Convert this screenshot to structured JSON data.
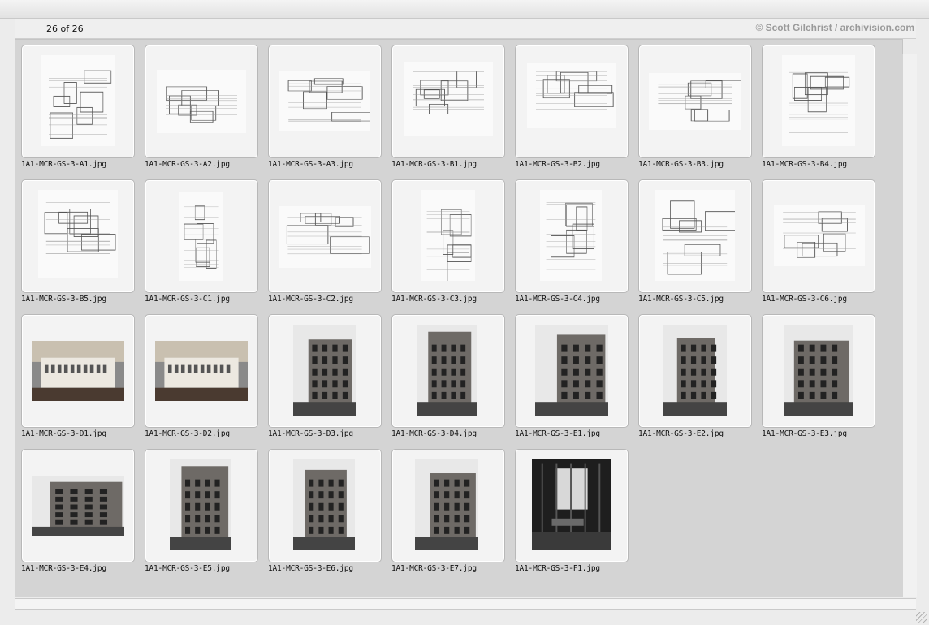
{
  "header": {
    "count_text": "26 of 26",
    "credit_text": "© Scott Gilchrist / archivision.com"
  },
  "thumbnails": [
    {
      "file": "1A1-MCR-GS-3-A1.jpg",
      "kind": "drawing"
    },
    {
      "file": "1A1-MCR-GS-3-A2.jpg",
      "kind": "drawing"
    },
    {
      "file": "1A1-MCR-GS-3-A3.jpg",
      "kind": "drawing"
    },
    {
      "file": "1A1-MCR-GS-3-B1.jpg",
      "kind": "drawing"
    },
    {
      "file": "1A1-MCR-GS-3-B2.jpg",
      "kind": "drawing"
    },
    {
      "file": "1A1-MCR-GS-3-B3.jpg",
      "kind": "drawing"
    },
    {
      "file": "1A1-MCR-GS-3-B4.jpg",
      "kind": "drawing"
    },
    {
      "file": "1A1-MCR-GS-3-B5.jpg",
      "kind": "drawing"
    },
    {
      "file": "1A1-MCR-GS-3-C1.jpg",
      "kind": "drawing"
    },
    {
      "file": "1A1-MCR-GS-3-C2.jpg",
      "kind": "drawing"
    },
    {
      "file": "1A1-MCR-GS-3-C3.jpg",
      "kind": "drawing"
    },
    {
      "file": "1A1-MCR-GS-3-C4.jpg",
      "kind": "drawing"
    },
    {
      "file": "1A1-MCR-GS-3-C5.jpg",
      "kind": "drawing"
    },
    {
      "file": "1A1-MCR-GS-3-C6.jpg",
      "kind": "drawing"
    },
    {
      "file": "1A1-MCR-GS-3-D1.jpg",
      "kind": "photo-model"
    },
    {
      "file": "1A1-MCR-GS-3-D2.jpg",
      "kind": "photo-model"
    },
    {
      "file": "1A1-MCR-GS-3-D3.jpg",
      "kind": "photo"
    },
    {
      "file": "1A1-MCR-GS-3-D4.jpg",
      "kind": "photo"
    },
    {
      "file": "1A1-MCR-GS-3-E1.jpg",
      "kind": "photo"
    },
    {
      "file": "1A1-MCR-GS-3-E2.jpg",
      "kind": "photo"
    },
    {
      "file": "1A1-MCR-GS-3-E3.jpg",
      "kind": "photo"
    },
    {
      "file": "1A1-MCR-GS-3-E4.jpg",
      "kind": "photo"
    },
    {
      "file": "1A1-MCR-GS-3-E5.jpg",
      "kind": "photo"
    },
    {
      "file": "1A1-MCR-GS-3-E6.jpg",
      "kind": "photo"
    },
    {
      "file": "1A1-MCR-GS-3-E7.jpg",
      "kind": "photo"
    },
    {
      "file": "1A1-MCR-GS-3-F1.jpg",
      "kind": "photo-interior"
    }
  ]
}
